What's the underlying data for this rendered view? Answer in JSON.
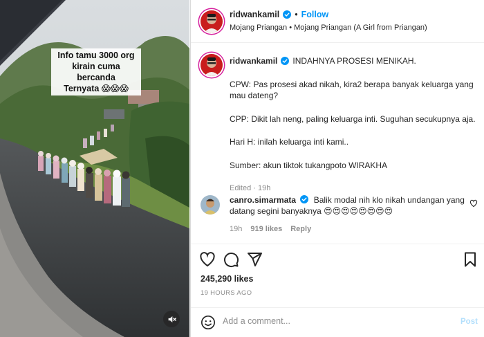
{
  "media": {
    "overlay_lines": [
      "Info tamu 3000 org",
      "kirain cuma bercanda",
      "Ternyata 😱😱😱"
    ],
    "mute_icon": "speaker-muted-icon"
  },
  "header": {
    "username": "ridwankamil",
    "separator": "•",
    "follow_label": "Follow",
    "location": "Mojang Priangan • Mojang Priangan (A Girl from Priangan)"
  },
  "caption": {
    "username": "ridwankamil",
    "title": "INDAHNYA PROSESI MENIKAH.",
    "paragraphs": [
      "CPW: Pas prosesi akad nikah, kira2 berapa banyak keluarga yang mau dateng?",
      "CPP: Dikit lah neng, paling keluarga inti. Suguhan secukupnya aja.",
      "Hari H: inilah keluarga inti kami..",
      "Sumber: akun tiktok tukangpoto WIRAKHA"
    ],
    "meta": "Edited · 19h"
  },
  "comment": {
    "username": "canro.simarmata",
    "text": "Balik modal nih klo nikah undangan yang datang segini banyaknya 😍😍😍😍😍😍😍😍",
    "time": "19h",
    "likes": "919 likes",
    "reply_label": "Reply"
  },
  "actions": {
    "icons": [
      "heart-icon",
      "comment-icon",
      "share-icon",
      "bookmark-icon"
    ]
  },
  "likes": "245,290 likes",
  "time_ago": "19 HOURS AGO",
  "add_comment": {
    "placeholder": "Add a comment...",
    "post_label": "Post"
  },
  "colors": {
    "accent": "#0095f6",
    "post_disabled": "#b2dffc",
    "verified": "#0095f6",
    "muted_text": "#8e8e8e"
  }
}
